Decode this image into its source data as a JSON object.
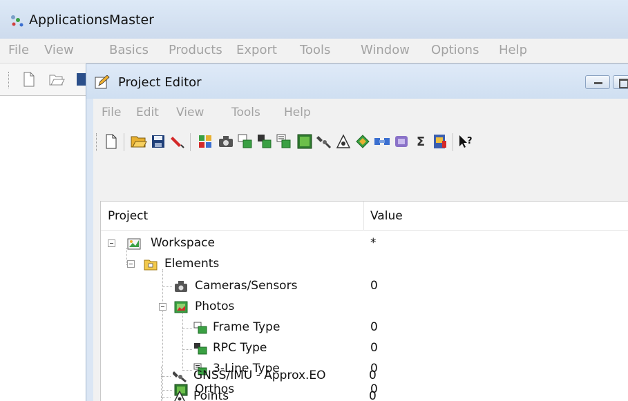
{
  "app": {
    "title": "ApplicationsMaster",
    "menu": [
      "File",
      "View",
      "Basics",
      "Products",
      "Export",
      "Tools",
      "Window",
      "Options",
      "Help"
    ]
  },
  "child": {
    "title": "Project Editor",
    "menu": [
      "File",
      "Edit",
      "View",
      "Tools",
      "Help"
    ],
    "toolbar_icons": [
      "new-file-icon",
      "open-folder-icon",
      "save-icon",
      "marker-icon",
      "project-settings-icon",
      "camera-icon",
      "frame-type-icon",
      "rpc-type-icon",
      "three-line-type-icon",
      "ortho-icon",
      "satellite-icon",
      "points-icon",
      "diamond-icon",
      "tie-points-icon",
      "blocks-icon",
      "sigma-icon",
      "report-icon",
      "context-help-icon"
    ]
  },
  "grid": {
    "columns": [
      "Project",
      "Value"
    ],
    "rows": [
      {
        "label": "Workspace",
        "value": "*"
      },
      {
        "label": "Elements",
        "value": ""
      },
      {
        "label": "Cameras/Sensors",
        "value": "0"
      },
      {
        "label": "Photos",
        "value": ""
      },
      {
        "label": "Frame Type",
        "value": "0"
      },
      {
        "label": "RPC Type",
        "value": "0"
      },
      {
        "label": "3-Line Type",
        "value": "0"
      },
      {
        "label": "Orthos",
        "value": "0"
      },
      {
        "label": "GNSS/IMU - Approx.EO",
        "value": "0"
      },
      {
        "label": "Points",
        "value": "0"
      }
    ]
  },
  "colors": {
    "titlebar": "#cddbed",
    "disabled_menu": "#a3a3a3",
    "folder": "#f2c94c",
    "green": "#3aa043"
  }
}
